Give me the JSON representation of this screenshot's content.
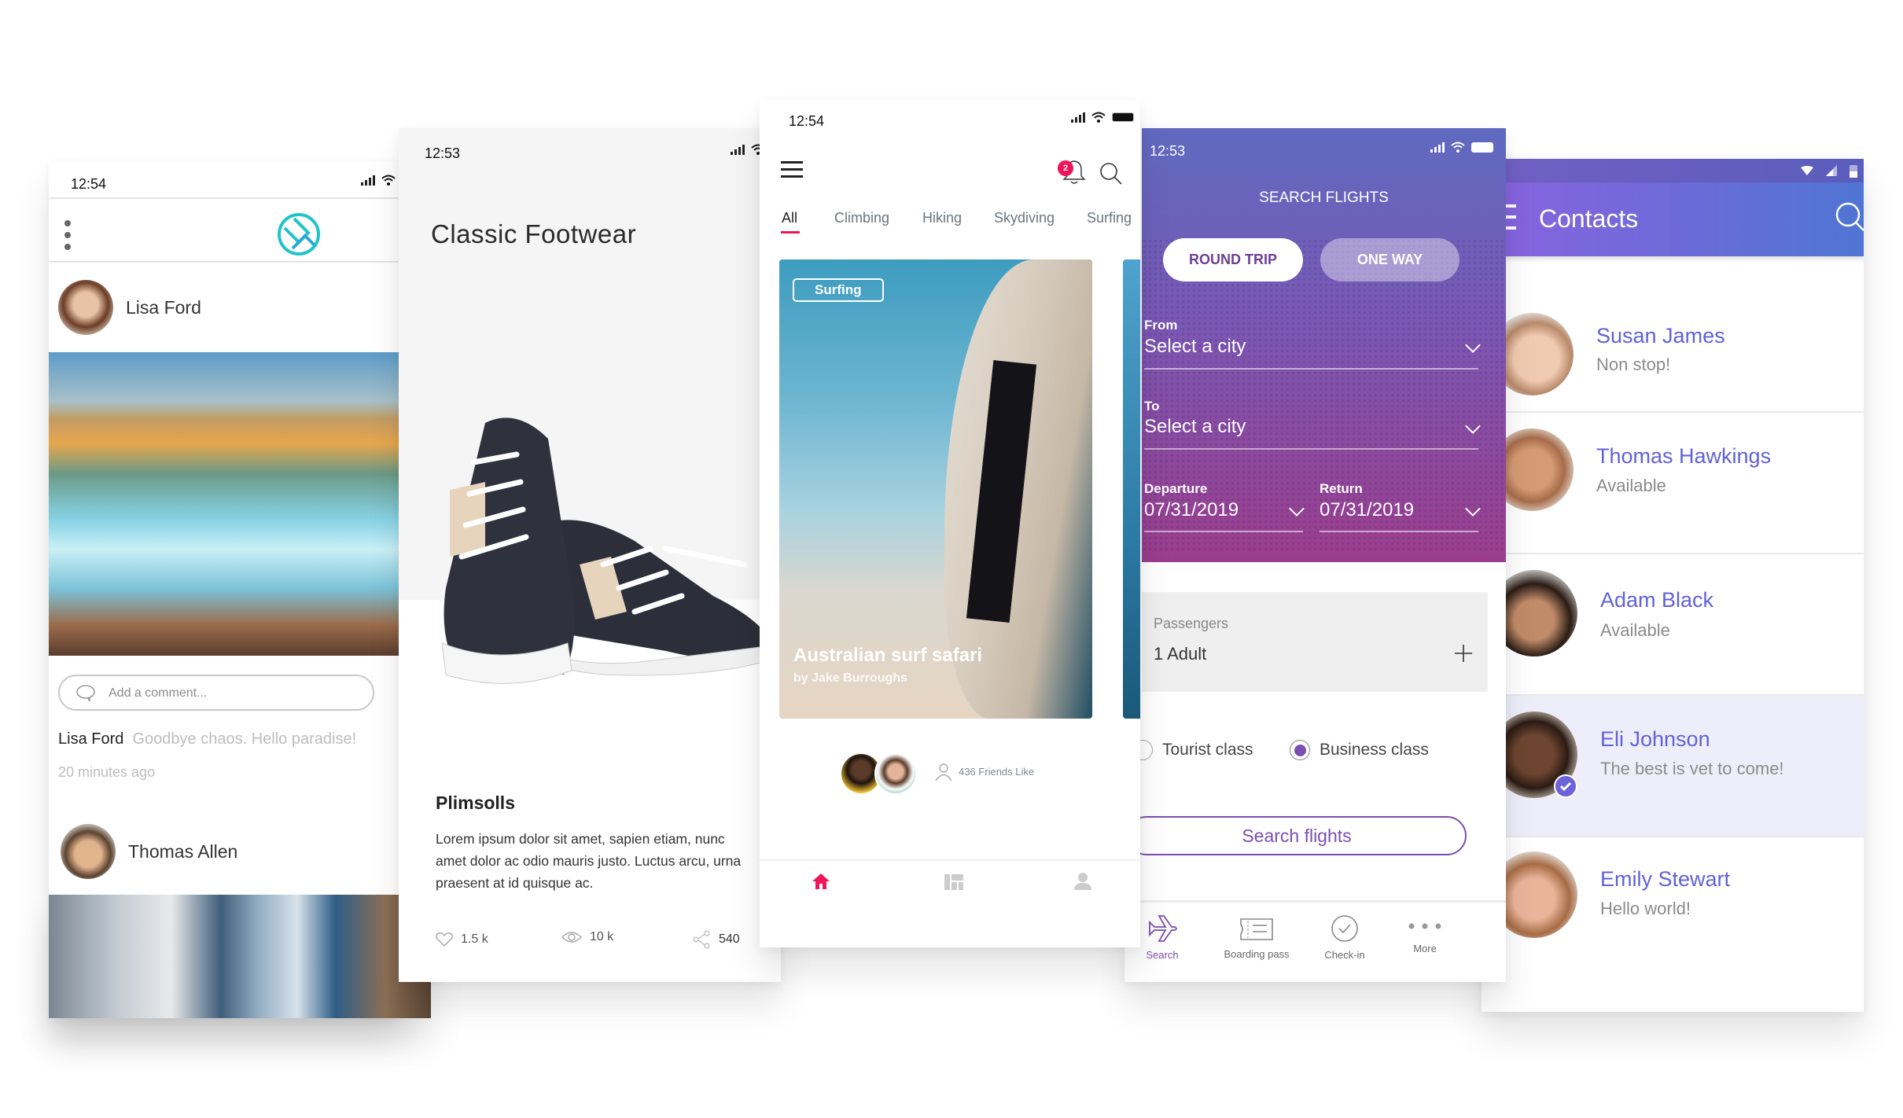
{
  "feed_app": {
    "status_time": "12:54",
    "menu_icon": "more-vertical-icon",
    "logo_icon": "app-logo-icon",
    "accent": "#1fc4c9",
    "post_author": "Lisa Ford",
    "comment_placeholder": "Add a comment...",
    "caption_author": "Lisa Ford",
    "caption_text": "Goodbye chaos. Hello paradise!",
    "timestamp": "20 minutes ago",
    "next_author": "Thomas Allen"
  },
  "shop_app": {
    "status_time": "12:53",
    "title": "Classic Footwear",
    "product_name": "Plimsolls",
    "description": "Lorem ipsum dolor sit amet, sapien etiam, nunc amet dolor ac odio mauris justo. Luctus arcu, urna praesent at id quisque ac.",
    "likes": "1.5 k",
    "views": "10 k",
    "shares": "540"
  },
  "activity_app": {
    "status_time": "12:54",
    "notification_count": "2",
    "accent": "#f0145a",
    "tabs": [
      {
        "label": "All",
        "active": true
      },
      {
        "label": "Climbing",
        "active": false
      },
      {
        "label": "Hiking",
        "active": false
      },
      {
        "label": "Skydiving",
        "active": false
      },
      {
        "label": "Surfing",
        "active": false
      }
    ],
    "card": {
      "tag": "Surfing",
      "title": "Australian surf safari",
      "author": "by Jake Burroughs"
    },
    "friends_like": "436 Friends Like",
    "bottom_nav": [
      "home-icon",
      "dashboard-icon",
      "profile-icon"
    ]
  },
  "flight_app": {
    "status_time": "12:53",
    "header": "SEARCH FLIGHTS",
    "trip_types": [
      {
        "label": "ROUND TRIP",
        "selected": true
      },
      {
        "label": "ONE WAY",
        "selected": false
      }
    ],
    "from": {
      "label": "From",
      "value": "Select a city"
    },
    "to": {
      "label": "To",
      "value": "Select a city"
    },
    "departure": {
      "label": "Departure",
      "value": "07/31/2019"
    },
    "return": {
      "label": "Return",
      "value": "07/31/2019"
    },
    "passengers": {
      "label": "Passengers",
      "value": "1 Adult"
    },
    "classes": [
      {
        "label": "Tourist class",
        "selected": false
      },
      {
        "label": "Business class",
        "selected": true
      }
    ],
    "search_button": "Search flights",
    "accent": "#7b4fb0",
    "bottom_nav": [
      {
        "label": "Search",
        "icon": "airplane-icon",
        "active": true
      },
      {
        "label": "Boarding pass",
        "icon": "ticket-icon",
        "active": false
      },
      {
        "label": "Check-in",
        "icon": "check-circle-icon",
        "active": false
      },
      {
        "label": "More",
        "icon": "more-horizontal-icon",
        "active": false
      }
    ]
  },
  "contacts_app": {
    "title": "Contacts",
    "accent": "#6161d8",
    "contacts": [
      {
        "name": "Susan James",
        "status": "Non stop!",
        "selected": false
      },
      {
        "name": "Thomas Hawkings",
        "status": "Available",
        "selected": false
      },
      {
        "name": "Adam Black",
        "status": "Available",
        "selected": false
      },
      {
        "name": "Eli Johnson",
        "status": "The best is vet to come!",
        "selected": true
      },
      {
        "name": "Emily Stewart",
        "status": "Hello world!",
        "selected": false
      }
    ]
  }
}
